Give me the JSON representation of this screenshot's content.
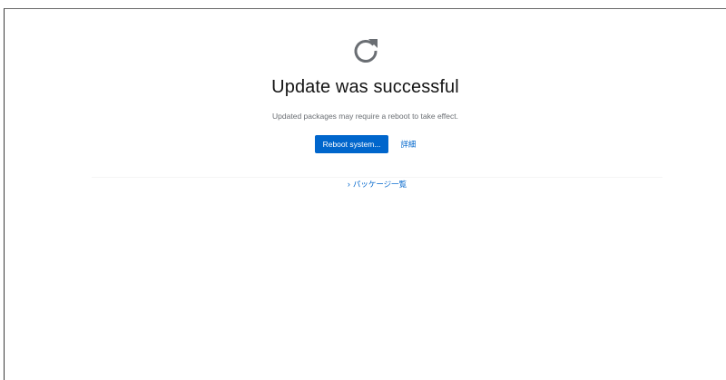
{
  "status": {
    "icon": "redo-icon",
    "title": "Update was successful",
    "message": "Updated packages may require a reboot to take effect."
  },
  "actions": {
    "reboot_label": "Reboot system...",
    "details_label": "詳細"
  },
  "packages": {
    "toggle_label": "パッケージ一覧",
    "expanded": false
  },
  "colors": {
    "primary": "#0066cc",
    "title": "#151515",
    "muted": "#6a6e73"
  }
}
